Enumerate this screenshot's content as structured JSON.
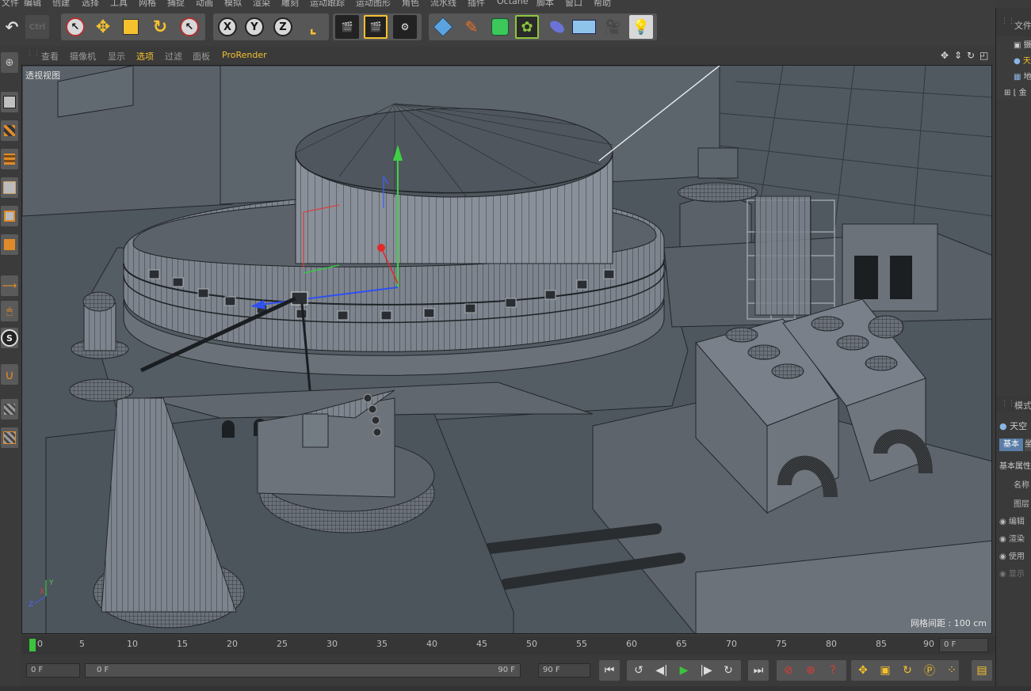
{
  "menu": [
    "文件",
    "编辑",
    "创建",
    "选择",
    "工具",
    "网格",
    "捕捉",
    "动画",
    "模拟",
    "渲染",
    "雕刻",
    "运动跟踪",
    "运动图形",
    "角色",
    "流水线",
    "插件",
    "Octane",
    "脚本",
    "窗口",
    "帮助"
  ],
  "toolbar": {
    "undo_icon": "undo-icon",
    "axis_x": "X",
    "axis_y": "Y",
    "axis_z": "Z"
  },
  "viewport_menu": [
    "查看",
    "摄像机",
    "显示",
    "选项",
    "过滤",
    "面板",
    "ProRender"
  ],
  "viewport": {
    "label": "透视视图",
    "grid_spacing": "网格间距 : 100 cm",
    "axis_y": "Y",
    "axis_x": "X",
    "axis_z": "Z"
  },
  "timeline": {
    "ticks": [
      "0",
      "5",
      "10",
      "15",
      "20",
      "25",
      "30",
      "35",
      "40",
      "45",
      "50",
      "55",
      "60",
      "65",
      "70",
      "75",
      "80",
      "85",
      "90"
    ],
    "current_frame": "0 F"
  },
  "transport": {
    "start_field": "0 F",
    "range_start": "0 F",
    "range_end": "90 F",
    "end_field": "90 F"
  },
  "right_panel": {
    "objects_header": "文件",
    "objects": [
      "摄",
      "天",
      "地",
      "金"
    ],
    "attr_header": "模式",
    "attr_obj": "天空",
    "attr_tab_basic": "基本",
    "attr_tab_coord": "坐",
    "attr_section": "基本属性",
    "attr_rows": [
      "名称",
      "图层",
      "编辑",
      "渲染",
      "使用",
      "显示"
    ]
  },
  "colors": {
    "accent": "#f5c12e",
    "viewport_bg": "#4a5259",
    "record": "#d0302a",
    "play": "#3bc43b"
  }
}
